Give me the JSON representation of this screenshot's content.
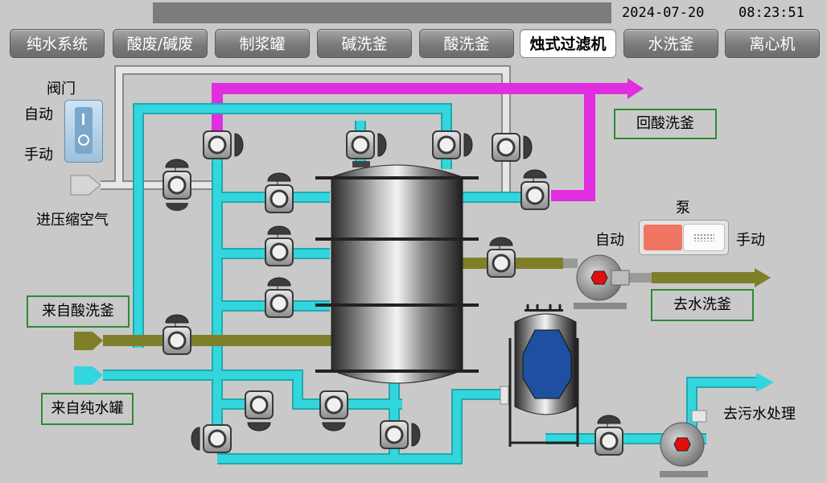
{
  "header": {
    "date": "2024-07-20",
    "time": "08:23:51"
  },
  "tabs": [
    {
      "label": "纯水系统",
      "active": false
    },
    {
      "label": "酸废/碱废",
      "active": false
    },
    {
      "label": "制浆罐",
      "active": false
    },
    {
      "label": "碱洗釜",
      "active": false
    },
    {
      "label": "酸洗釜",
      "active": false
    },
    {
      "label": "烛式过滤机",
      "active": true
    },
    {
      "label": "水洗釜",
      "active": false
    },
    {
      "label": "离心机",
      "active": false
    }
  ],
  "valve_control": {
    "title": "阀门",
    "auto_label": "自动",
    "manual_label": "手动",
    "mode": "自动"
  },
  "pump_control": {
    "title": "泵",
    "auto_label": "自动",
    "manual_label": "手动",
    "mode": "自动"
  },
  "labels": {
    "air_inlet": "进压缩空气",
    "from_acid_wash": "来自酸洗釜",
    "from_pure_water": "来自纯水罐",
    "return_acid": "回酸洗釜",
    "to_water_wash": "去水洗釜",
    "to_waste": "去污水处理"
  },
  "colors": {
    "water": "#33d6dc",
    "acid_return": "#e02ee0",
    "slurry": "#7f7f2a",
    "air": "#dcdcdc",
    "pump_indicator": "#e01010",
    "tank_indicator": "#1f4fa0"
  }
}
